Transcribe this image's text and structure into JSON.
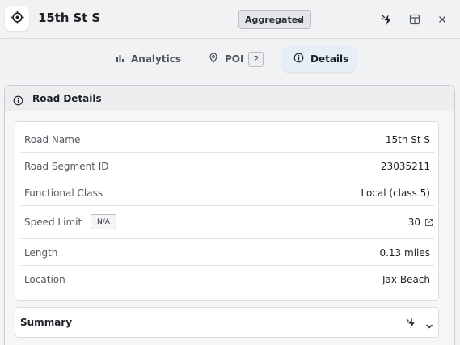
{
  "header": {
    "title": "15th St S",
    "aggregation_label": "Aggregated"
  },
  "tabs": [
    {
      "label": "Analytics",
      "icon": "bar-chart-icon",
      "active": false
    },
    {
      "label": "POI",
      "icon": "map-pin-icon",
      "count": "2",
      "active": false
    },
    {
      "label": "Details",
      "icon": "info-icon",
      "active": true
    }
  ],
  "road_details": {
    "title": "Road Details",
    "rows": [
      {
        "label": "Road Name",
        "value": "15th St S"
      },
      {
        "label": "Road Segment ID",
        "value": "23035211"
      },
      {
        "label": "Functional Class",
        "value": "Local (class 5)"
      },
      {
        "label": "Speed Limit",
        "badge": "N/A",
        "value": "30"
      },
      {
        "label": "Length",
        "value": "0.13 miles"
      },
      {
        "label": "Location",
        "value": "Jax Beach"
      }
    ]
  },
  "summary": {
    "title": "Summary"
  }
}
